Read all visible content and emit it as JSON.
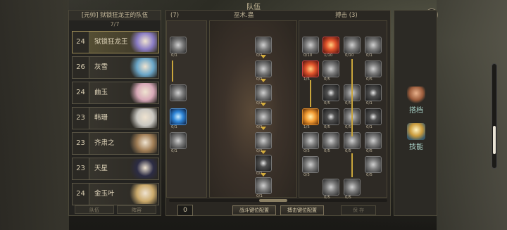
{
  "window": {
    "title": "队伍"
  },
  "team": {
    "title": "[元帅] 狱锁狂龙王的队伍",
    "count": "7/7",
    "tabs": [
      "队伍",
      "阵容"
    ],
    "heroes": [
      {
        "level": "24",
        "name": "狱锁狂龙王",
        "selected": true,
        "accent": "#8a7cc4"
      },
      {
        "level": "26",
        "name": "灰雪",
        "selected": false,
        "accent": "#6aa6c8"
      },
      {
        "level": "24",
        "name": "曲玉",
        "selected": false,
        "accent": "#d6a7b6"
      },
      {
        "level": "23",
        "name": "韩珊",
        "selected": false,
        "accent": "#c8c6c0"
      },
      {
        "level": "23",
        "name": "齐肃之",
        "selected": false,
        "accent": "#a07d55"
      },
      {
        "level": "23",
        "name": "天星",
        "selected": false,
        "accent": "#2c2c44"
      },
      {
        "level": "24",
        "name": "金玉叶",
        "selected": false,
        "accent": "#c9a86a"
      }
    ]
  },
  "skills": {
    "left_header": "(7)",
    "mid_header": "巫术.蟲",
    "right_header": "搏击 (3)",
    "left_labels": [
      "0/1",
      "0/1",
      "0/1"
    ],
    "mid_labels": [
      "0/1",
      "0/1",
      "0/1",
      "0/1",
      "0/1",
      "0/1",
      "0/1"
    ],
    "right_labels": {
      "r1": [
        "0/10",
        "1/10",
        "0/10",
        "0/1"
      ],
      "r2": [
        "1/5",
        "0/5",
        "0/5"
      ],
      "r3": [
        "0/5",
        "0/5",
        "0/1"
      ],
      "r4": [
        "1/5",
        "0/5",
        "0/5",
        "0/1"
      ],
      "r5": [
        "0/5",
        "0/5",
        "0/5",
        "0/5"
      ],
      "r6": [
        "0/5",
        "0/5"
      ],
      "r7": [
        "0/5",
        "0/5"
      ]
    }
  },
  "bottom": {
    "points": "0",
    "combat_config": "战斗键位配置",
    "melee_config": "搏击键位配置",
    "save": "保 存"
  },
  "side_tabs": [
    {
      "label": "搭档",
      "icon": "arm-icon"
    },
    {
      "label": "技能",
      "icon": "skillbook-icon"
    }
  ],
  "colors": {
    "accent": "#c9a53c",
    "panel": "#2a2722",
    "selected": "#5b5436"
  }
}
